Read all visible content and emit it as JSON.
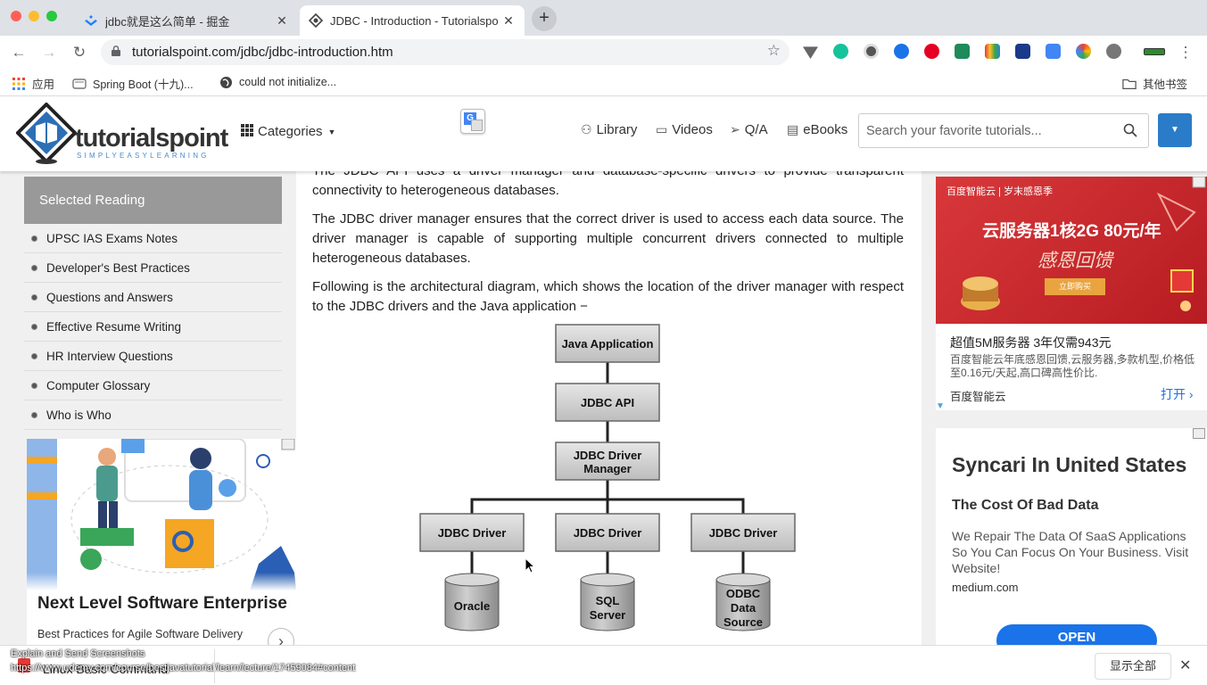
{
  "browser": {
    "tabs": [
      {
        "title": "jdbc就是这么简单 - 掘金",
        "active": false,
        "icon": "juejin-icon"
      },
      {
        "title": "JDBC - Introduction - Tutorialspo",
        "active": true,
        "icon": "tutorialspoint-icon"
      }
    ],
    "new_tab": "+",
    "url": "tutorialspoint.com/jdbc/jdbc-introduction.htm",
    "bookmarks": [
      {
        "label": "应用",
        "icon": "apps-grid-icon"
      },
      {
        "label": "Spring Boot (十九)...",
        "icon": "page-icon"
      },
      {
        "label": "could not initialize...",
        "icon": "globe-icon"
      }
    ],
    "other_bookmarks": "其他书签"
  },
  "site": {
    "logo_text": "tutorialspoint",
    "logo_sub": "SIMPLYEASYLEARNING",
    "categories": "Categories",
    "nav": [
      {
        "label": "Library",
        "icon": "library-icon"
      },
      {
        "label": "Videos",
        "icon": "video-icon"
      },
      {
        "label": "Q/A",
        "icon": "paper-plane-icon"
      },
      {
        "label": "eBooks",
        "icon": "book-icon"
      }
    ],
    "search_placeholder": "Search your favorite tutorials..."
  },
  "sidebar": {
    "heading": "Selected Reading",
    "items": [
      "UPSC IAS Exams Notes",
      "Developer's Best Practices",
      "Questions and Answers",
      "Effective Resume Writing",
      "HR Interview Questions",
      "Computer Glossary",
      "Who is Who"
    ],
    "ad": {
      "title": "Next Level Software Enterprise",
      "subtitle": "Best Practices for Agile Software Delivery"
    }
  },
  "main": {
    "paragraphs": [
      "The JDBC API uses a driver manager and database-specific drivers to provide transparent connectivity to heterogeneous databases.",
      "The JDBC driver manager ensures that the correct driver is used to access each data source. The driver manager is capable of supporting multiple concurrent drivers connected to multiple heterogeneous databases.",
      "Following is the architectural diagram, which shows the location of the driver manager with respect to the JDBC drivers and the Java application −"
    ],
    "diagram": {
      "app": "Java Application",
      "api": "JDBC API",
      "manager_line1": "JDBC Driver",
      "manager_line2": "Manager",
      "drivers": [
        "JDBC Driver",
        "JDBC Driver",
        "JDBC Driver"
      ],
      "db1": "Oracle",
      "db2_line1": "SQL",
      "db2_line2": "Server",
      "db3_line1": "ODBC",
      "db3_line2": "Data",
      "db3_line3": "Source"
    }
  },
  "right_ads": {
    "baidu": {
      "brand_tag": "百度智能云 | 岁末感恩季",
      "headline": "云服务器1核2G 80元/年",
      "slogan": "感恩回馈",
      "button": "立即购买",
      "title": "超值5M服务器 3年仅需943元",
      "desc": "百度智能云年底感恩回馈,云服务器,多款机型,价格低至0.16元/天起,高口碑高性价比.",
      "brand": "百度智能云",
      "cta": "打开"
    },
    "syncari": {
      "title": "Syncari In United States",
      "subtitle": "The Cost Of Bad Data",
      "body": "We Repair The Data Of SaaS Applications So You Can Focus On Your Business. Visit Website!",
      "domain": "medium.com",
      "cta": "OPEN"
    }
  },
  "bottom_bar": {
    "overlay_title": "Explain and Send Screenshots",
    "status_url": "https://www.udemy.com/course/bestjavatutorial/learn/lecture/17459084#content",
    "partial_text": "Linux Basic Command",
    "show_all": "显示全部",
    "close": "✕"
  },
  "colors": {
    "accent_blue": "#2b7cc8",
    "sidebar_head": "#999999",
    "baidu_red": "#c8282a",
    "open_button": "#1a73e8"
  }
}
